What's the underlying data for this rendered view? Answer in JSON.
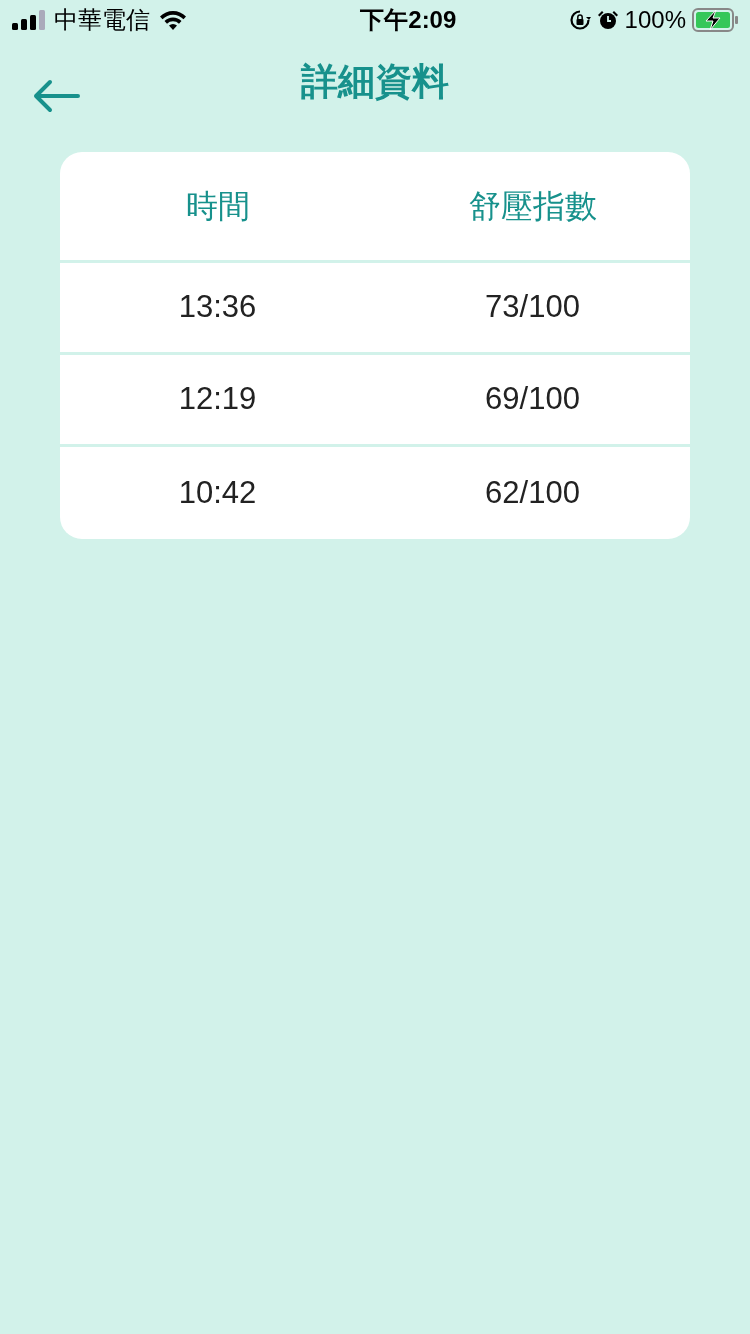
{
  "status_bar": {
    "carrier": "中華電信",
    "time": "下午2:09",
    "battery": "100%"
  },
  "header": {
    "title": "詳細資料"
  },
  "table": {
    "columns": [
      "時間",
      "舒壓指數"
    ],
    "rows": [
      [
        "13:36",
        "73/100"
      ],
      [
        "12:19",
        "69/100"
      ],
      [
        "10:42",
        "62/100"
      ]
    ]
  }
}
